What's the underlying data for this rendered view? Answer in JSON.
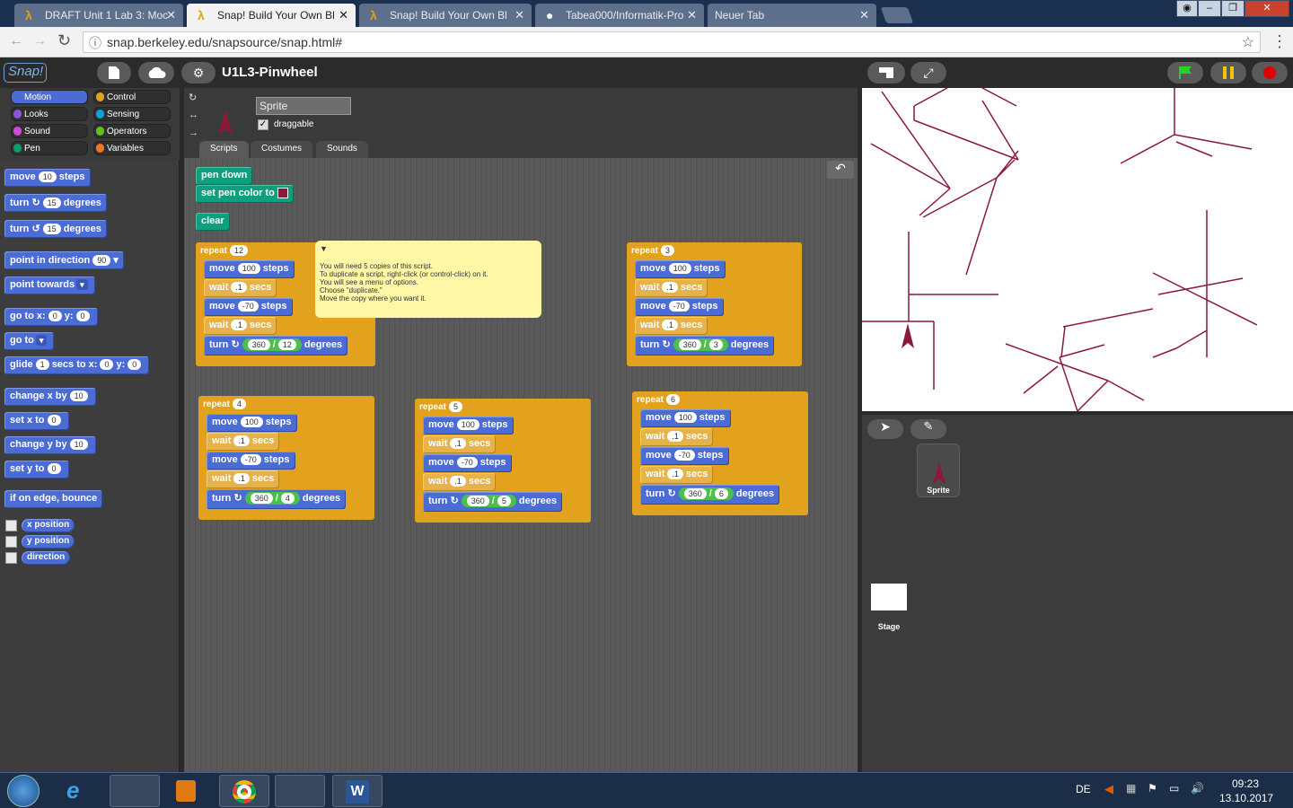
{
  "browser": {
    "tabs": [
      {
        "label": "DRAFT Unit 1 Lab 3: Moc"
      },
      {
        "label": "Snap! Build Your Own Bl"
      },
      {
        "label": "Snap! Build Your Own Bl"
      },
      {
        "label": "Tabea000/Informatik-Pro"
      },
      {
        "label": "Neuer Tab"
      }
    ],
    "url": "snap.berkeley.edu/snapsource/snap.html#",
    "close_symbol": "✕",
    "star": "☆",
    "menu": "⋮",
    "back": "←",
    "forward": "→",
    "reload": "↻",
    "info": "ⓘ"
  },
  "snap": {
    "logo": "Snap!",
    "project_title": "U1L3-Pinwheel",
    "categories": [
      "Motion",
      "Control",
      "Looks",
      "Sensing",
      "Sound",
      "Operators",
      "Pen",
      "Variables"
    ],
    "palette": {
      "move": "move",
      "move_val": "10",
      "steps": "steps",
      "turn": "turn",
      "turn_val": "15",
      "degrees": "degrees",
      "point_dir": "point in direction",
      "point_dir_val": "90",
      "point_towards": "point towards",
      "goto_xy": "go to x:",
      "x_val": "0",
      "y": "y:",
      "y_val": "0",
      "goto": "go to",
      "glide": "glide",
      "glide_val": "1",
      "secs_to_x": "secs to x:",
      "change_x": "change x by",
      "change_val": "10",
      "set_x": "set x to",
      "set_val": "0",
      "change_y": "change y by",
      "set_y": "set y to",
      "bounce": "if on edge, bounce",
      "xpos": "x position",
      "ypos": "y position",
      "direction": "direction"
    },
    "sprite_name": "Sprite",
    "draggable": "draggable",
    "tabs": [
      "Scripts",
      "Costumes",
      "Sounds"
    ],
    "scripts": {
      "pen_down": "pen down",
      "set_pen_color": "set pen color to",
      "clear": "clear",
      "repeat": "repeat",
      "move": "move",
      "wait": "wait",
      "steps": "steps",
      "secs": "secs",
      "turn": "turn",
      "degrees": "degrees",
      "v100": "100",
      "vneg70": "-70",
      "vdot1": ".1",
      "v360": "360",
      "slash": "/",
      "r12": "12",
      "r3": "3",
      "r4": "4",
      "r5": "5",
      "r6": "6"
    },
    "comment": [
      "You will need 5 copies of this script.",
      "To duplicate a script, right-click (or control-click) on it.",
      "You will see a menu of options.",
      "Choose \"duplicate.\"",
      "Move the copy where you want it."
    ],
    "corral": {
      "sprite": "Sprite",
      "stage": "Stage"
    }
  },
  "taskbar": {
    "lang": "DE",
    "time": "09:23",
    "date": "13.10.2017"
  },
  "colors": {
    "pen": "#8b1a3a",
    "motion": "#4a6cd4",
    "control": "#e2a21d"
  }
}
